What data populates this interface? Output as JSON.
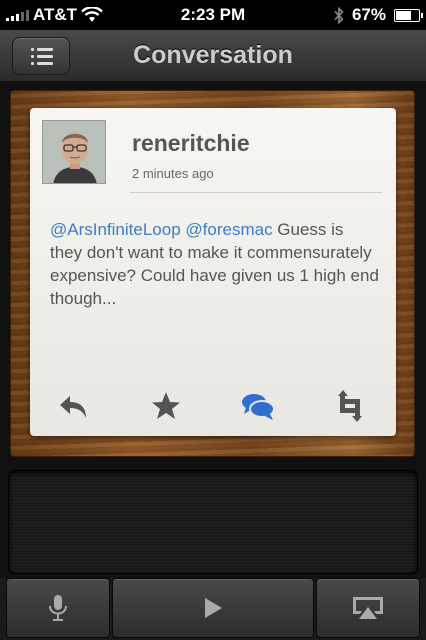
{
  "status_bar": {
    "carrier": "AT&T",
    "time": "2:23 PM",
    "battery_percent": "67%",
    "battery_level": 0.67,
    "icons": [
      "signal-icon",
      "wifi-icon",
      "bluetooth-icon",
      "battery-icon"
    ]
  },
  "nav": {
    "title": "Conversation",
    "back_icon": "list-menu-icon"
  },
  "tweet": {
    "username": "reneritchie",
    "timestamp": "2 minutes ago",
    "mention1": "@ArsInfiniteLoop",
    "mention2": "@foresmac",
    "text": " Guess is they don't want to make it commensurately expensive? Could have given us 1 high end though...",
    "actions": [
      "reply-icon",
      "favorite-star-icon",
      "conversation-icon",
      "retweet-icon"
    ]
  },
  "toolbar": {
    "buttons": [
      "microphone-icon",
      "play-icon",
      "airplay-icon"
    ]
  },
  "colors": {
    "mention": "#3f7cc4",
    "active_action": "#2f6fd0",
    "wood": "#8a5426"
  }
}
